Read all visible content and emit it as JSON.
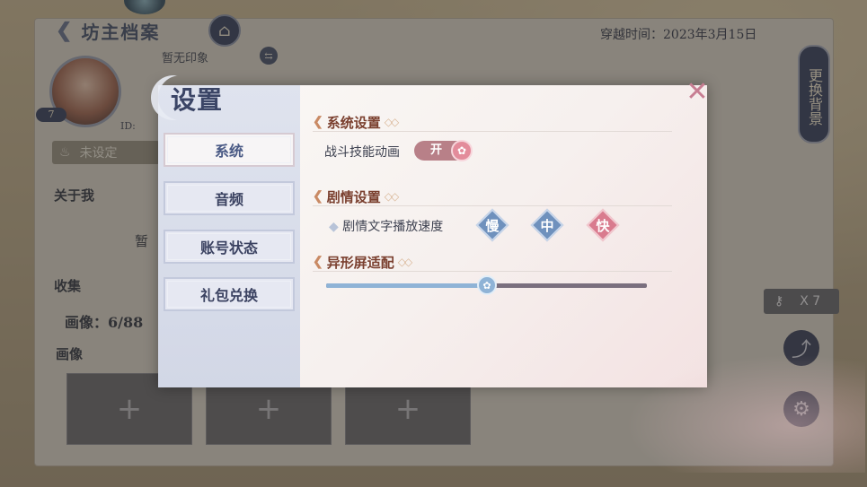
{
  "background": {
    "title": "坊主档案",
    "date": "穿越时间：2023年3月15日",
    "no_impression": "暂无印象",
    "level": "7",
    "id_label": "ID:",
    "not_set": "未设定",
    "about_me": "关于我",
    "zan": "暂",
    "collection": "收集",
    "portrait_count": "画像：6/88",
    "portrait": "画像",
    "slot_plus": "+",
    "change_bg": "更换背景",
    "key_count": "X 7"
  },
  "settings": {
    "title": "设置",
    "close_icon": "✕",
    "tabs": [
      {
        "label": "系统",
        "active": true
      },
      {
        "label": "音频",
        "active": false
      },
      {
        "label": "账号状态",
        "active": false
      },
      {
        "label": "礼包兑换",
        "active": false
      }
    ],
    "system_section": "系统设置",
    "battle_anim_label": "战斗技能动画",
    "battle_anim_state": "开",
    "story_section": "剧情设置",
    "text_speed_label": "剧情文字播放速度",
    "speed_options": [
      "慢",
      "中",
      "快"
    ],
    "screen_section": "异形屏适配",
    "screen_adapt_value": 0.5
  },
  "colors": {
    "accent_blue": "#6f91bd",
    "accent_pink": "#d97b8e",
    "section_title": "#7a3f2e"
  }
}
